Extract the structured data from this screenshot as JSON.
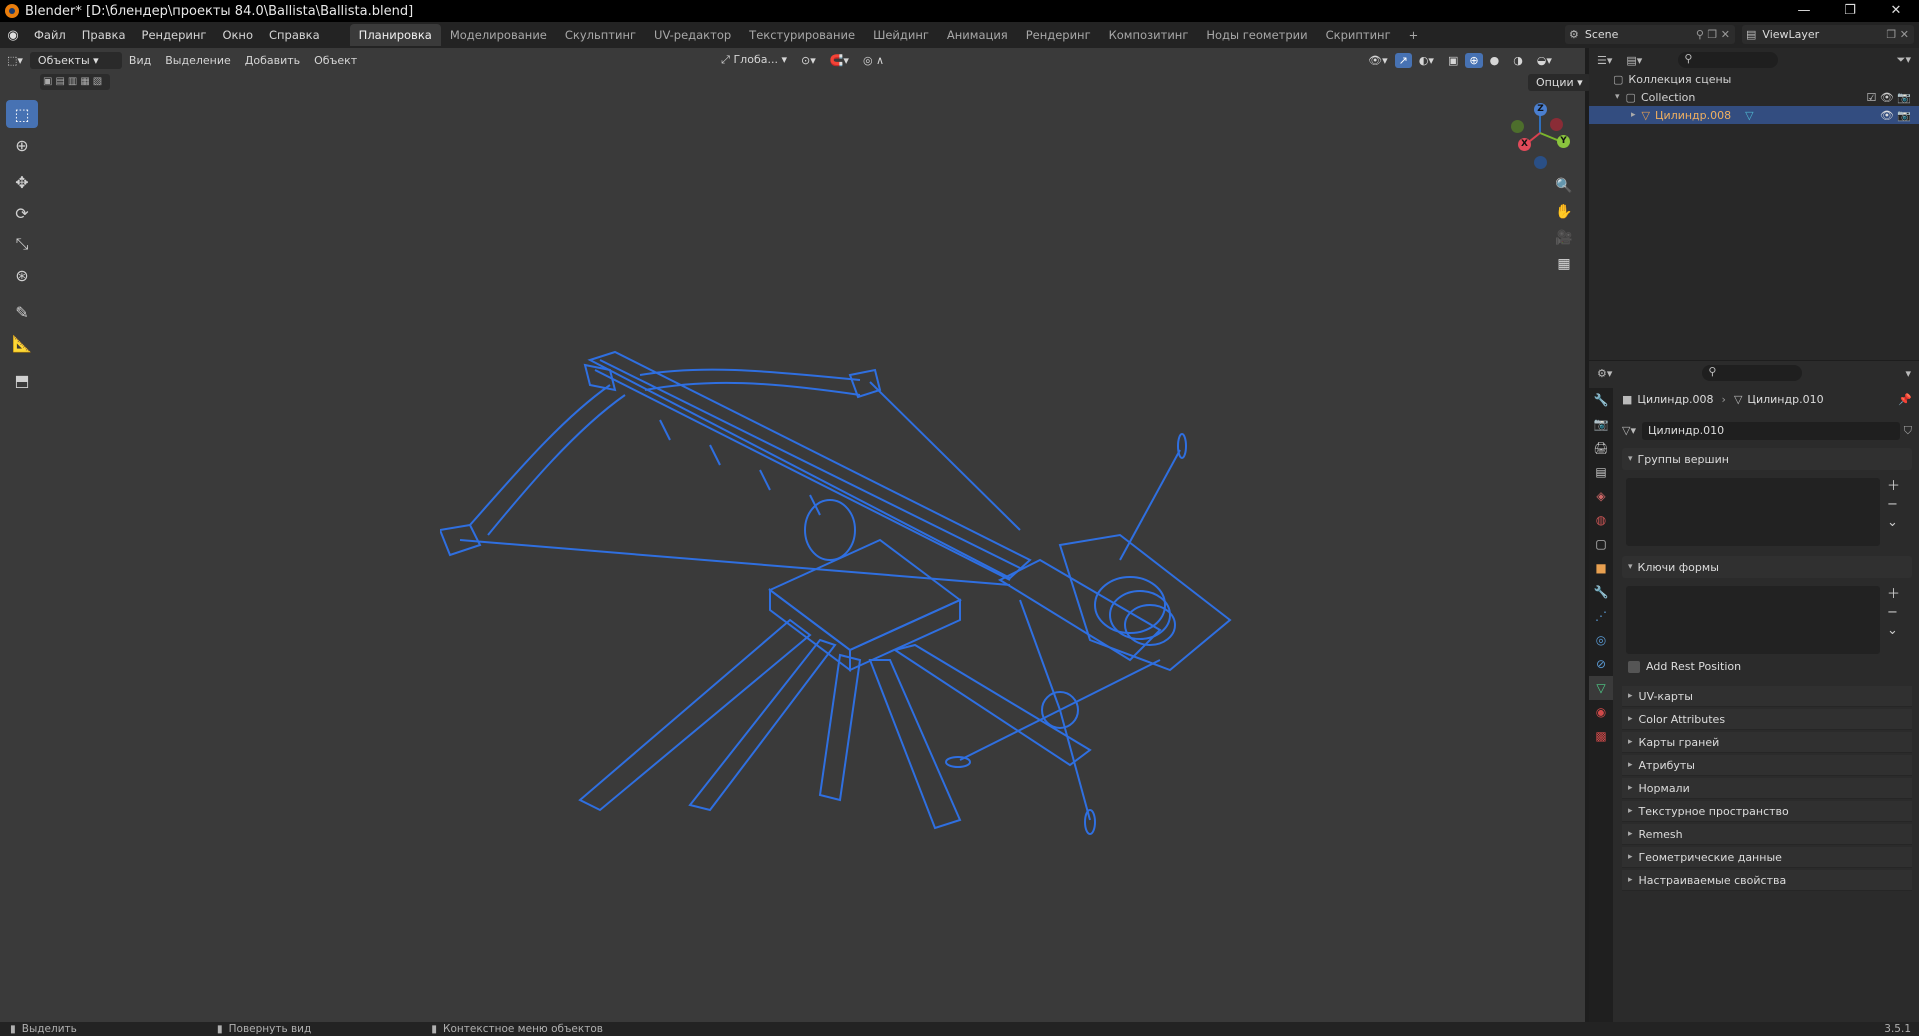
{
  "window": {
    "title": "Blender* [D:\\блендер\\проекты 84.0\\Ballista\\Ballista.blend]",
    "controls": [
      "—",
      "❐",
      "✕"
    ]
  },
  "menu": [
    "Файл",
    "Правка",
    "Рендеринг",
    "Окно",
    "Справка"
  ],
  "workspaces": [
    "Планировка",
    "Моделирование",
    "Скульптинг",
    "UV-редактор",
    "Текстурирование",
    "Шейдинг",
    "Анимация",
    "Рендеринг",
    "Композитинг",
    "Ноды геометрии",
    "Скриптинг",
    "+"
  ],
  "scene": {
    "label": "Scene",
    "view_layer": "ViewLayer"
  },
  "viewport": {
    "mode": "Объекты",
    "menus": [
      "Вид",
      "Выделение",
      "Добавить",
      "Объект"
    ],
    "transform_orientation": "Глоба...",
    "options": "Опции",
    "gizmo": {
      "z": "Z",
      "y": "Y",
      "x": "X"
    },
    "wire_color": "#2f6fe0"
  },
  "outliner": {
    "root": "Коллекция сцены",
    "collection": "Collection",
    "object": "Цилиндр.008"
  },
  "properties": {
    "breadcrumb_object": "Цилиндр.008",
    "breadcrumb_mesh": "Цилиндр.010",
    "mesh_name": "Цилиндр.010",
    "vertex_groups": "Группы вершин",
    "shape_keys": "Ключи формы",
    "add_rest_position": "Add Rest Position",
    "sections": [
      "UV-карты",
      "Color Attributes",
      "Карты граней",
      "Атрибуты",
      "Нормали",
      "Текстурное пространство",
      "Remesh",
      "Геометрические данные",
      "Настраиваемые свойства"
    ]
  },
  "status": {
    "select": "Выделить",
    "rotate": "Повернуть вид",
    "context": "Контекстное меню объектов",
    "version": "3.5.1"
  }
}
